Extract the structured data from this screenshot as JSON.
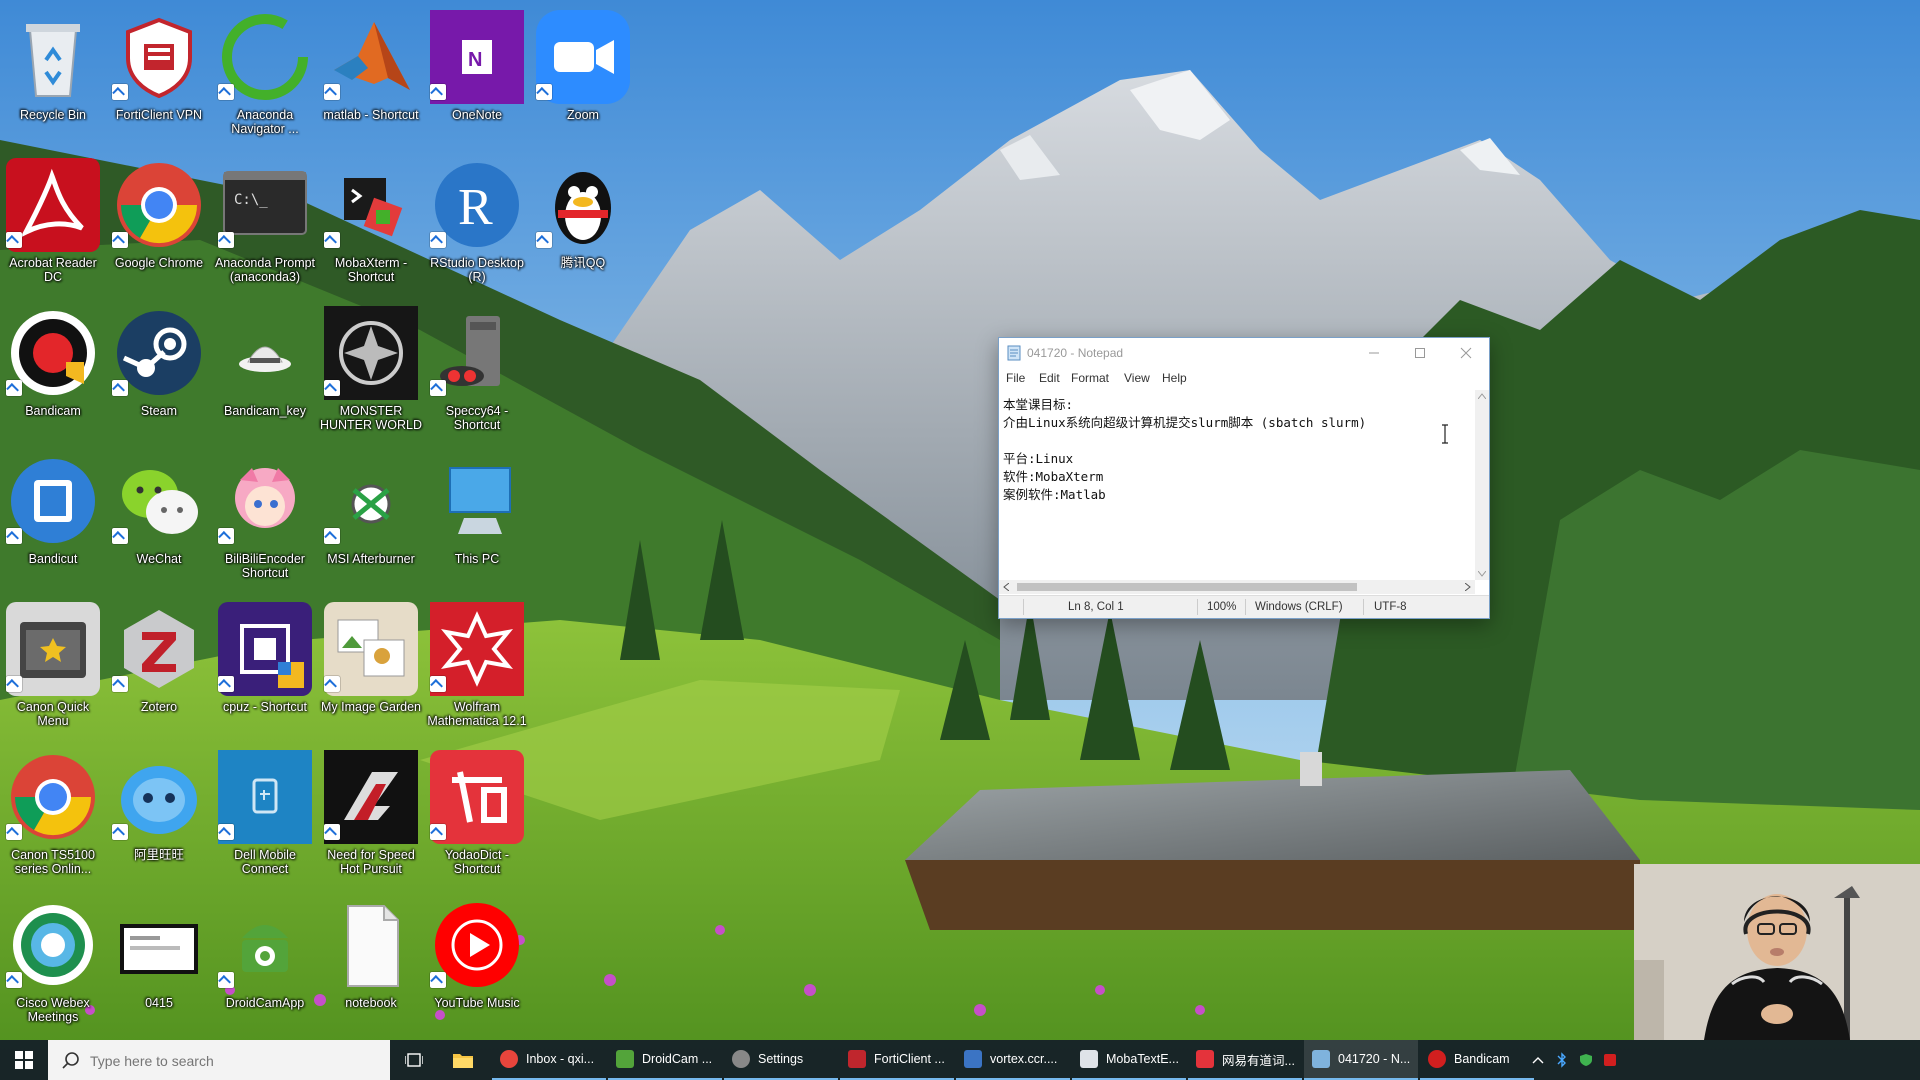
{
  "desktop": {
    "icons": [
      {
        "label": "Recycle Bin"
      },
      {
        "label": "FortiClient VPN"
      },
      {
        "label": "Anaconda Navigator ..."
      },
      {
        "label": "matlab - Shortcut"
      },
      {
        "label": "OneNote"
      },
      {
        "label": "Zoom"
      },
      {
        "label": "Acrobat Reader DC"
      },
      {
        "label": "Google Chrome"
      },
      {
        "label": "Anaconda Prompt (anaconda3)"
      },
      {
        "label": "MobaXterm - Shortcut"
      },
      {
        "label": "RStudio Desktop (R)"
      },
      {
        "label": "腾讯QQ"
      },
      {
        "label": "Bandicam"
      },
      {
        "label": "Steam"
      },
      {
        "label": "Bandicam_key"
      },
      {
        "label": "MONSTER HUNTER WORLD"
      },
      {
        "label": "Speccy64 - Shortcut"
      },
      {
        "label": "Bandicut"
      },
      {
        "label": "WeChat"
      },
      {
        "label": "BiliBiliEncoder Shortcut"
      },
      {
        "label": "MSI Afterburner"
      },
      {
        "label": "This PC"
      },
      {
        "label": "Canon Quick Menu"
      },
      {
        "label": "Zotero"
      },
      {
        "label": "cpuz - Shortcut"
      },
      {
        "label": "My Image Garden"
      },
      {
        "label": "Wolfram Mathematica 12.1"
      },
      {
        "label": "Canon TS5100 series Onlin..."
      },
      {
        "label": "阿里旺旺"
      },
      {
        "label": "Dell Mobile Connect"
      },
      {
        "label": "Need for Speed Hot Pursuit"
      },
      {
        "label": "YodaoDict - Shortcut"
      },
      {
        "label": "Cisco Webex Meetings"
      },
      {
        "label": "0415"
      },
      {
        "label": "DroidCamApp"
      },
      {
        "label": "notebook"
      },
      {
        "label": "YouTube Music"
      }
    ]
  },
  "notepad": {
    "title": "041720 - Notepad",
    "menu": [
      "File",
      "Edit",
      "Format",
      "View",
      "Help"
    ],
    "lines": [
      "本堂课目标:",
      "介由Linux系统向超级计算机提交slurm脚本 (sbatch slurm)",
      "",
      "平台:Linux",
      "软件:MobaXterm",
      "案例软件:Matlab"
    ],
    "status": {
      "position": "Ln 8, Col 1",
      "zoom": "100%",
      "line_ending": "Windows (CRLF)",
      "encoding": "UTF-8"
    }
  },
  "taskbar": {
    "search_placeholder": "Type here to search",
    "apps": [
      {
        "label": "Inbox - qxi...",
        "color": "#e8453c"
      },
      {
        "label": "DroidCam ...",
        "color": "#53a43a"
      },
      {
        "label": "Settings",
        "color": "#888888"
      },
      {
        "label": "FortiClient ...",
        "color": "#c0262d"
      },
      {
        "label": "vortex.ccr....",
        "color": "#3b74c4"
      },
      {
        "label": "MobaTextE...",
        "color": "#dfe3e8"
      },
      {
        "label": "网易有道词...",
        "color": "#e4333b"
      },
      {
        "label": "041720 - N...",
        "color": "#7fb3dd"
      },
      {
        "label": "Bandicam",
        "color": "#d11f1f"
      }
    ]
  }
}
